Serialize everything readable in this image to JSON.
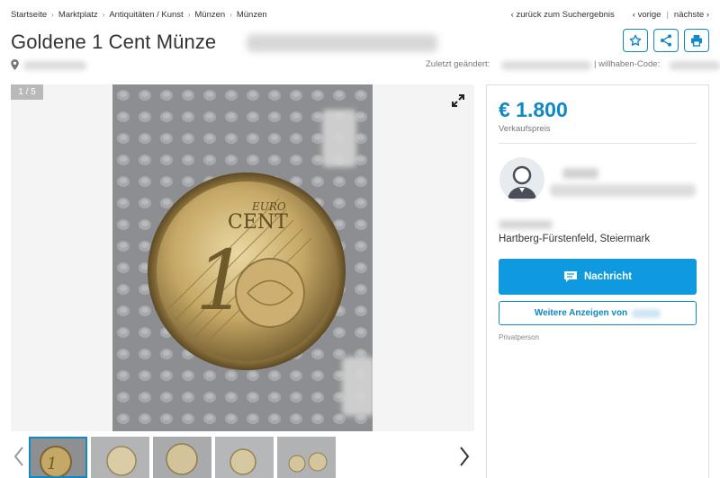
{
  "breadcrumb": [
    "Startseite",
    "Marktplatz",
    "Antiquitäten / Kunst",
    "Münzen",
    "Münzen"
  ],
  "nav": {
    "back": "‹ zurück zum Suchergebnis",
    "prev": "‹ vorige",
    "sep": "|",
    "next": "nächste ›"
  },
  "listing": {
    "title": "Goldene 1 Cent Münze",
    "changed_label": "Zuletzt geändert:",
    "code_label": "| willhaben-Code:"
  },
  "gallery": {
    "counter": "1 / 5",
    "coin_top": "EURO",
    "coin_main": "CENT",
    "coin_value": "1"
  },
  "side": {
    "price": "€ 1.800",
    "price_label": "Verkaufspreis",
    "region": "Hartberg-Fürstenfeld, Steiermark",
    "message_btn": "Nachricht",
    "more_btn": "Weitere Anzeigen von",
    "seller_type": "Privatperson"
  },
  "colors": {
    "accent": "#0f88c4",
    "button": "#0f9ae0"
  },
  "icons": [
    "star-icon",
    "share-icon",
    "print-icon",
    "location-pin-icon",
    "expand-icon",
    "chat-icon",
    "avatar-icon",
    "chevron-left-icon",
    "chevron-right-icon"
  ]
}
